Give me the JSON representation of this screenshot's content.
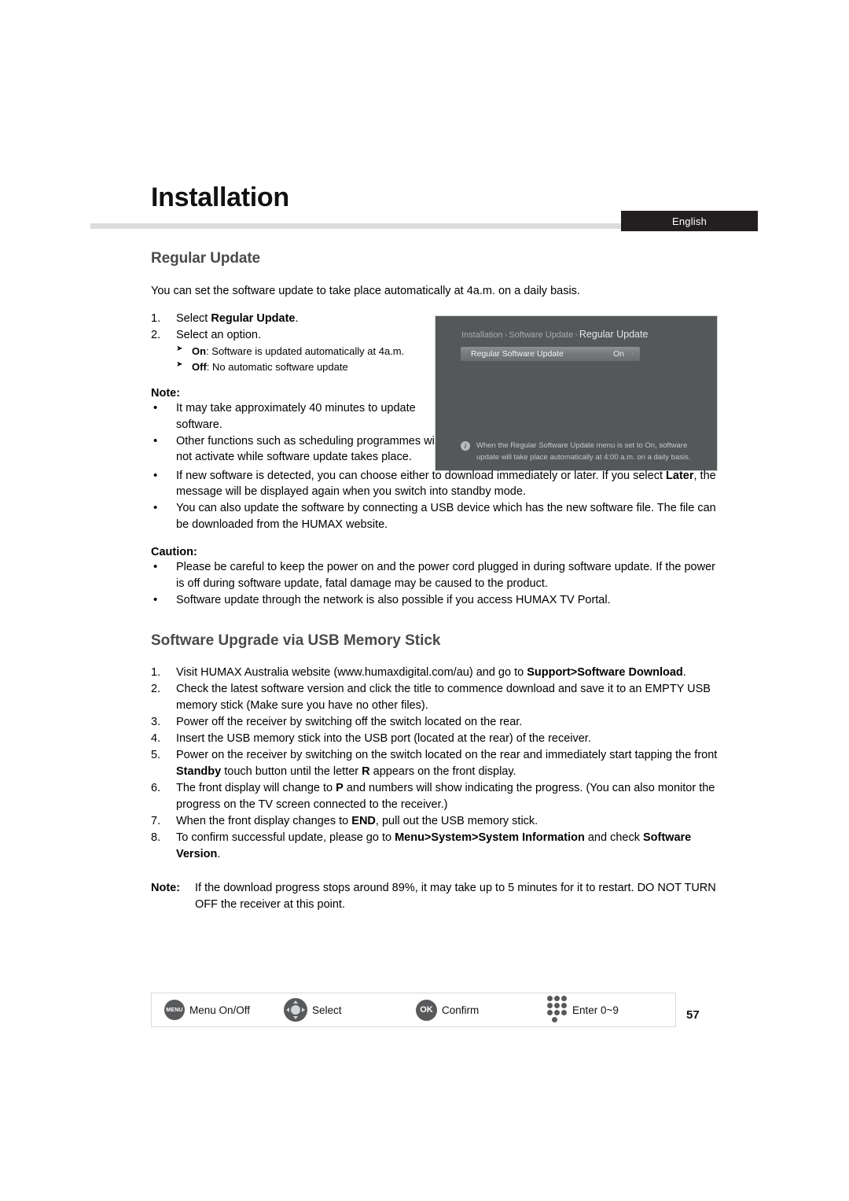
{
  "header": {
    "title": "Installation",
    "language_tab": "English"
  },
  "sections": {
    "regular_update": {
      "heading": "Regular Update",
      "intro": "You can set the software update to take place automatically at 4a.m. on a daily basis.",
      "steps": [
        {
          "num": "1.",
          "text_before": "Select ",
          "bold": "Regular Update",
          "text_after": "."
        },
        {
          "num": "2.",
          "text_before": "Select an option.",
          "bold": "",
          "text_after": ""
        }
      ],
      "sub_options": [
        {
          "arrow": "➤",
          "bold": "On",
          "text": ": Software is updated automatically at 4a.m."
        },
        {
          "arrow": "➤",
          "bold": "Off",
          "text": ": No automatic software update"
        }
      ],
      "note_label": "Note:",
      "note_bullets_narrow": [
        "It may take approximately 40 minutes to update software.",
        "Other functions such as scheduling programmes will not activate while software update takes place."
      ],
      "note_bullet_later": {
        "part1": "If new software is detected, you can choose either to download immediately or later. If you select ",
        "bold": "Later",
        "part2": ", the message will be displayed again when you switch into standby mode."
      },
      "note_bullet_usb": "You can also update the software by connecting a USB device which has the new software file. The file can be downloaded from the HUMAX website.",
      "caution_label": "Caution:",
      "caution_bullets": [
        "Please be careful to keep the power on and the power cord plugged in during software update. If the power is off during software update, fatal damage may be caused to the product.",
        "Software update through the network is also possible if you access HUMAX TV Portal."
      ]
    },
    "usb_upgrade": {
      "heading": "Software Upgrade via USB Memory Stick",
      "steps": [
        {
          "num": "1.",
          "p1": "Visit HUMAX Australia website (www.humaxdigital.com/au) and go to ",
          "b1": "Support>Software Download",
          "p2": ".",
          "b2": "",
          "p3": ""
        },
        {
          "num": "2.",
          "p1": "Check the latest software version and click the title to commence download and save it to an EMPTY USB memory stick (Make sure you have no other files).",
          "b1": "",
          "p2": "",
          "b2": "",
          "p3": ""
        },
        {
          "num": "3.",
          "p1": "Power off the receiver by switching off the switch located on the rear.",
          "b1": "",
          "p2": "",
          "b2": "",
          "p3": ""
        },
        {
          "num": "4.",
          "p1": "Insert the USB memory stick into the USB port (located at the rear) of the receiver.",
          "b1": "",
          "p2": "",
          "b2": "",
          "p3": ""
        },
        {
          "num": "5.",
          "p1": "Power on the receiver by switching on the switch located on the rear and immediately start tapping the front ",
          "b1": "Standby",
          "p2": " touch button until the letter ",
          "b2": "R",
          "p3": " appears on the front display."
        },
        {
          "num": "6.",
          "p1": "The front display will change to ",
          "b1": "P",
          "p2": " and numbers will show indicating the progress. (You can also monitor the progress on the TV screen connected to the receiver.)",
          "b2": "",
          "p3": ""
        },
        {
          "num": "7.",
          "p1": "When the front display changes to ",
          "b1": "END",
          "p2": ", pull out the USB memory stick.",
          "b2": "",
          "p3": ""
        },
        {
          "num": "8.",
          "p1": "To confirm successful update, please go to ",
          "b1": "Menu>System>System Information",
          "p2": " and check ",
          "b2": "Software Version",
          "p3": "."
        }
      ],
      "final_note": {
        "label": "Note:",
        "text": "If the download progress stops around 89%, it may take up to 5 minutes for it to restart. DO NOT TURN OFF the receiver at this point."
      }
    }
  },
  "tv_screenshot": {
    "breadcrumb_1": "Installation",
    "breadcrumb_2": "Software Update",
    "breadcrumb_current": "Regular Update",
    "separator": "›",
    "row_label": "Regular Software Update",
    "row_value": "On",
    "caret": "›",
    "info_icon": "i",
    "info_text": "When the Regular Software Update menu is set to On, software update will take place automatically at 4:00 a.m. on a daily basis."
  },
  "footer": {
    "legend": [
      {
        "icon": "menu-button-icon",
        "glyph": "MENU",
        "label": "Menu On/Off"
      },
      {
        "icon": "dpad-icon",
        "glyph": "",
        "label": "Select"
      },
      {
        "icon": "ok-button-icon",
        "glyph": "OK",
        "label": "Confirm"
      },
      {
        "icon": "numeric-keypad-icon",
        "glyph": "",
        "label": "Enter 0~9"
      }
    ],
    "page_number": "57"
  },
  "colors": {
    "heading_gray": "#4a4a4a",
    "rule_gray": "#dcdcdc",
    "tab_black": "#231f20",
    "tv_background": "#555759"
  }
}
